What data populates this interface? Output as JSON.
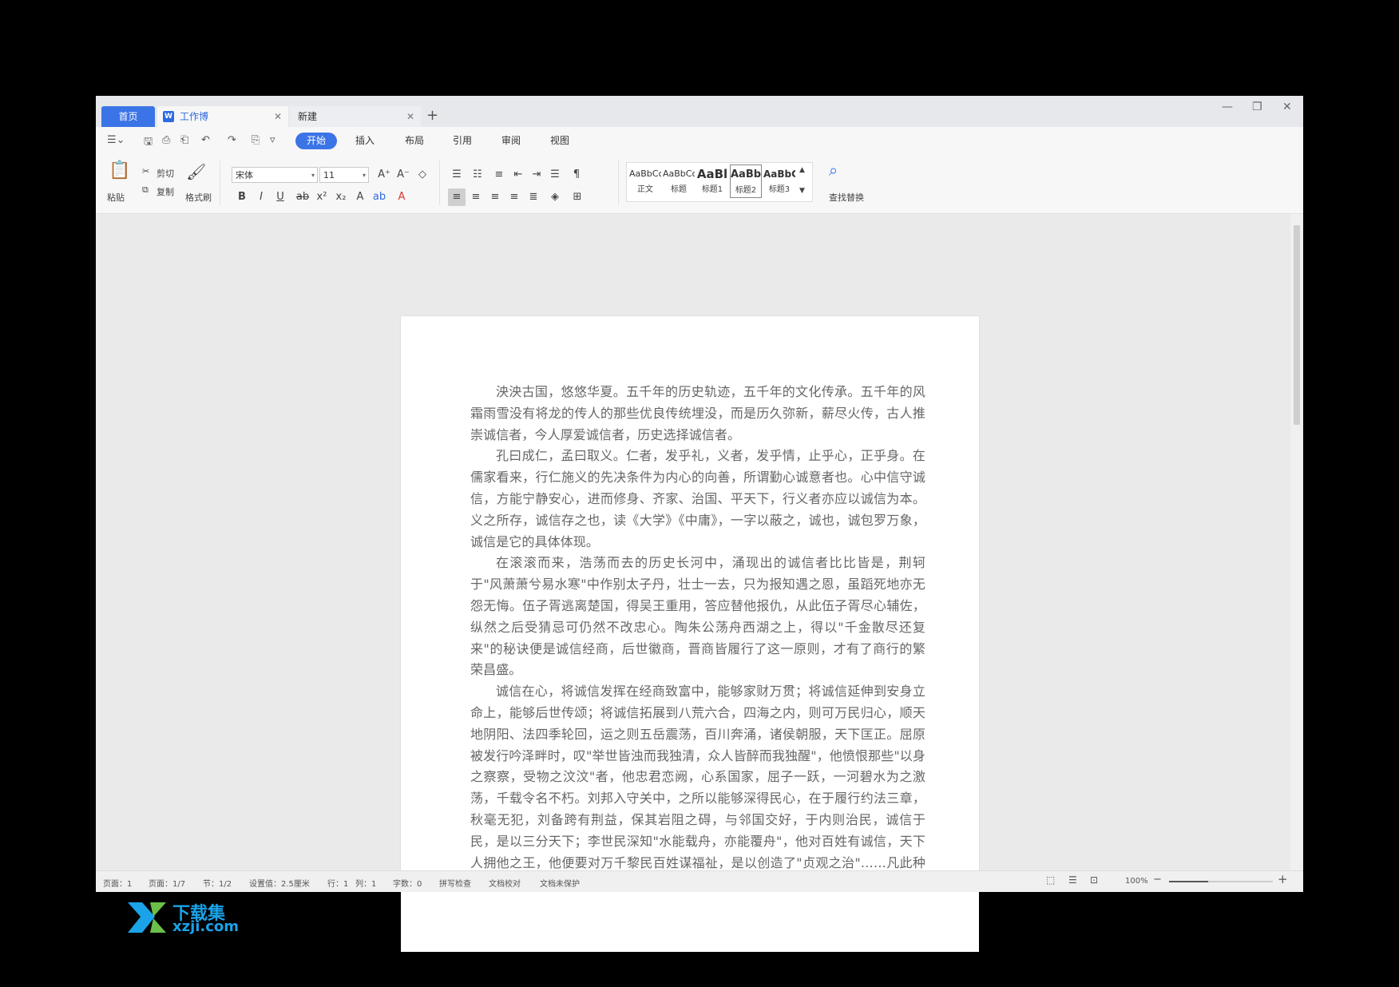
{
  "tabs": {
    "home": "首页",
    "doc": "工作博",
    "new": "新建",
    "close": "✕",
    "plus": "+"
  },
  "window": {
    "minimize": "—",
    "restore": "❐",
    "close": "✕"
  },
  "menu": {
    "items": [
      "开始",
      "插入",
      "布局",
      "引用",
      "审阅",
      "视图"
    ]
  },
  "ribbon": {
    "paste": "粘贴",
    "cut": "剪切",
    "copy": "复制",
    "format_painter": "格式刷",
    "font_name": "宋体",
    "font_size": "11",
    "find_replace": "查找替换",
    "styles": [
      {
        "sample": "AaBbCc",
        "label": "正文"
      },
      {
        "sample": "AaBbCc",
        "label": "标题"
      },
      {
        "sample": "AaBl",
        "label": "标题1"
      },
      {
        "sample": "AaBb",
        "label": "标题2"
      },
      {
        "sample": "AaBbC",
        "label": "标题3"
      }
    ]
  },
  "document": {
    "paragraphs": [
      "泱泱古国，悠悠华夏。五千年的历史轨迹，五千年的文化传承。五千年的风霜雨雪没有将龙的传人的那些优良传统埋没，而是历久弥新，薪尽火传，古人推崇诚信者，今人厚爱诚信者，历史选择诚信者。",
      "孔曰成仁，孟曰取义。仁者，发乎礼，义者，发乎情，止乎心，正乎身。在儒家看来，行仁施义的先决条件为内心的向善，所谓勤心诚意者也。心中信守诚信，方能宁静安心，进而修身、齐家、治国、平天下，行义者亦应以诚信为本。义之所存，诚信存之也，读《大学》《中庸》，一字以蔽之，诚也，诚包罗万象，诚信是它的具体体现。",
      "在滚滚而来，浩荡而去的历史长河中，涌现出的诚信者比比皆是，荆轲于\"风萧萧兮易水寒\"中作别太子丹，壮士一去，只为报知遇之恩，虽蹈死地亦无怨无悔。伍子胥逃离楚国，得吴王重用，答应替他报仇，从此伍子胥尽心辅佐，纵然之后受猜忌可仍然不改忠心。陶朱公荡舟西湖之上，得以\"千金散尽还复来\"的秘诀便是诚信经商，后世徽商，晋商皆履行了这一原则，才有了商行的繁荣昌盛。",
      "诚信在心，将诚信发挥在经商致富中，能够家财万贯；将诚信延伸到安身立命上，能够后世传颂；将诚信拓展到八荒六合，四海之内，则可万民归心，顺天地阴阳、法四季轮回，运之则五岳震荡，百川奔涌，诸侯朝服，天下匡正。屈原被发行吟泽畔时，叹\"举世皆浊而我独清，众人皆醉而我独醒\"，他愤恨那些\"以身之察察，受物之汶汶\"者，他忠君恋阙，心系国家，屈子一跃，一河碧水为之激荡，千载令名不朽。刘邦入守关中，之所以能够深得民心，在于履行约法三章，秋毫无犯，刘备跨有荆益，保其岩阻之碍，与邻国交好，于内则治民，诚信于民，是以三分天下；李世民深知\"水能载舟，亦能覆舟\"，他对百姓有诚信，天下人拥他之王，他便要对万千黎民百姓谋福祉，是以创造了\"贞观之治\"……凡此种种，皆言诚信为人立身之本，天道酬诚信。"
    ]
  },
  "status": {
    "page": "页面：1",
    "pages": "页面：1/7",
    "section": "节：1/2",
    "setting": "设置值：2.5厘米",
    "line": "行：1",
    "col": "列：1",
    "words": "字数：0",
    "spell": "拼写检查",
    "proof": "文档校对",
    "protect": "文档未保护",
    "zoom": "100%",
    "zoom_level": 0.38
  },
  "watermark": {
    "brand": "下载集",
    "domain": "xzji.com"
  }
}
